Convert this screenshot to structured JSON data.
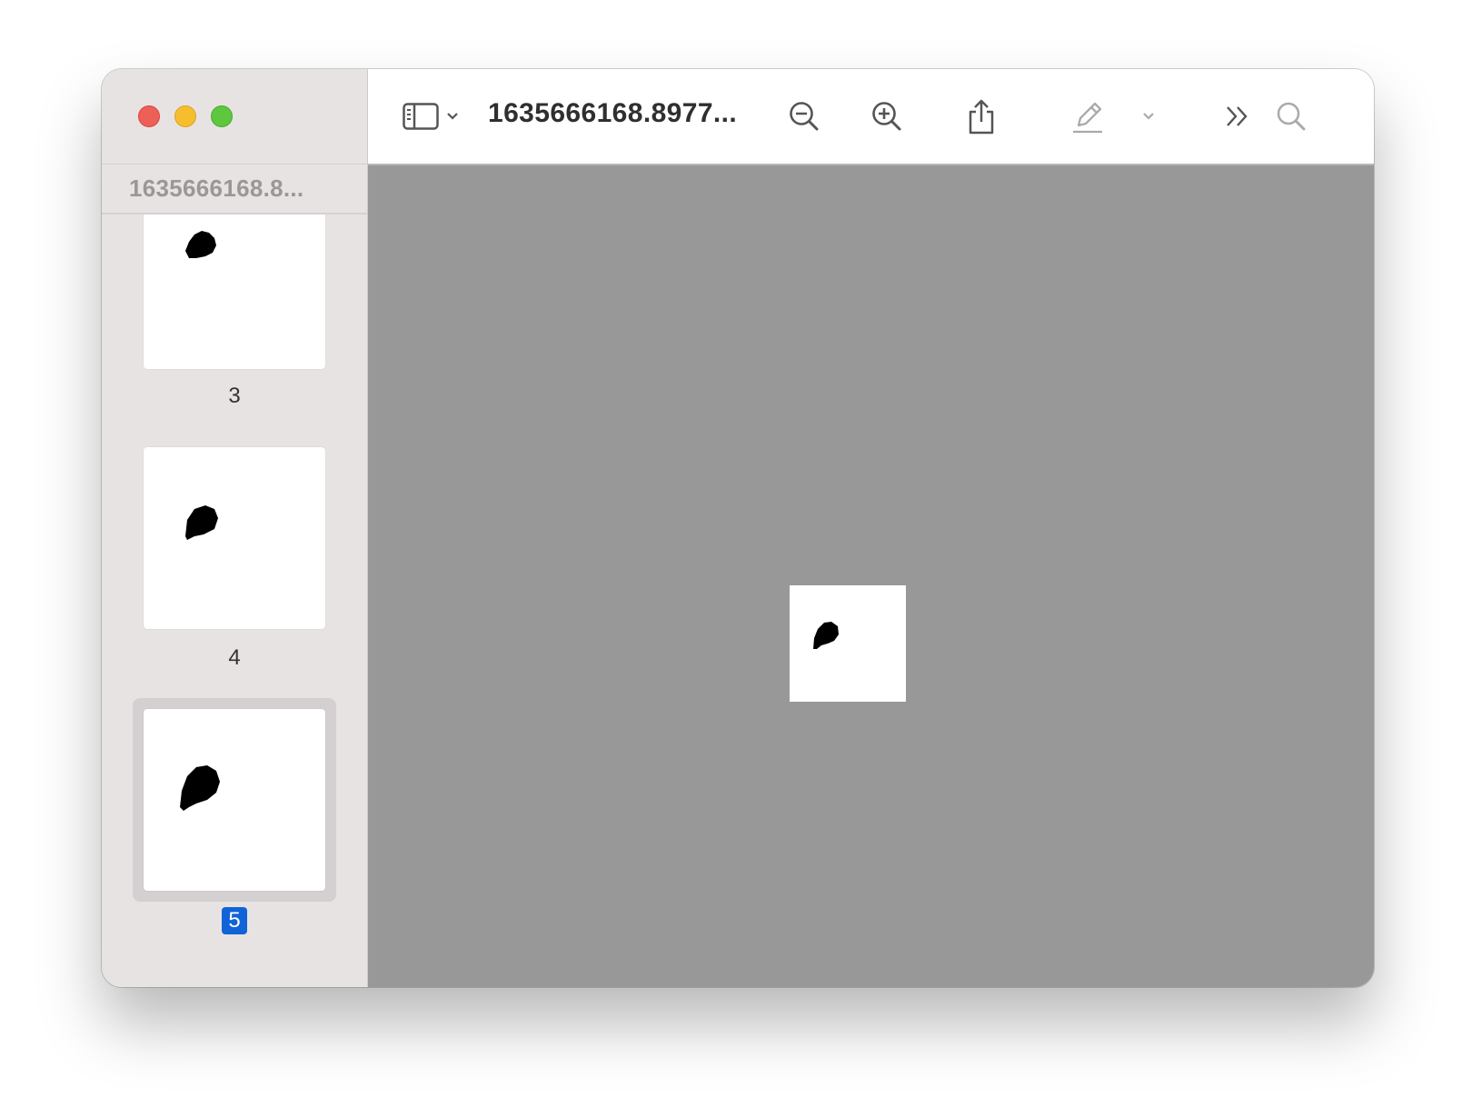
{
  "window": {
    "sidebar_title": "1635666168.8...",
    "document_title": "1635666168.8977..."
  },
  "thumbnails": [
    {
      "page_label": "3",
      "selected": false
    },
    {
      "page_label": "4",
      "selected": false
    },
    {
      "page_label": "5",
      "selected": true
    }
  ],
  "toolbar": {
    "icons": [
      "sidebar-toggle-icon",
      "chevron-down-icon",
      "zoom-out-icon",
      "zoom-in-icon",
      "share-icon",
      "markup-pen-icon",
      "chevron-down-icon",
      "more-tools-icon",
      "search-icon"
    ]
  },
  "colors": {
    "close": "#ee5f57",
    "minimize": "#f6be2f",
    "zoom": "#5ec73f",
    "selection_badge": "#1064d8",
    "canvas_background": "#989898"
  }
}
